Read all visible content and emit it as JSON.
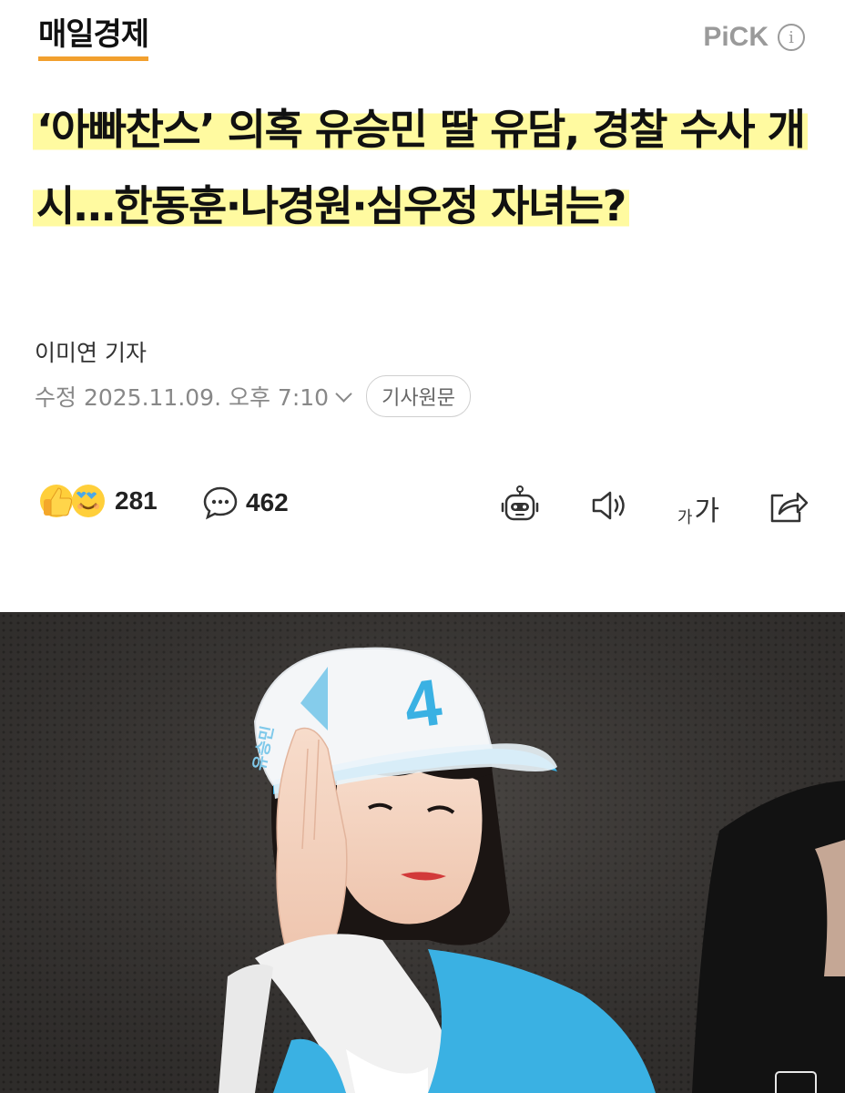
{
  "header": {
    "logo_text": "매일경제",
    "pick_label": "PiCK",
    "info_icon": "info-icon"
  },
  "article": {
    "title": "‘아빠찬스’ 의혹 유승민 딸 유담, 경찰 수사 개시…한동훈·나경원·심우정 자녀는?",
    "author": "이미연 기자",
    "date": "수정 2025.11.09. 오후 7:10",
    "original_button": "기사원문"
  },
  "actions": {
    "reaction_count": "281",
    "comment_count": "462",
    "font_size_label_small": "가",
    "font_size_label_large": "가",
    "icons": [
      "ai-summary-icon",
      "speaker-icon",
      "font-size-icon",
      "share-icon"
    ]
  },
  "photo": {
    "cap_number": "4",
    "cap_name": "유승민"
  },
  "colors": {
    "highlight": "#fffaa0",
    "logo_underline": "#f2a02e",
    "emoji_yellow": "#ffcf3a",
    "cap_blue": "#3ab1e3"
  }
}
